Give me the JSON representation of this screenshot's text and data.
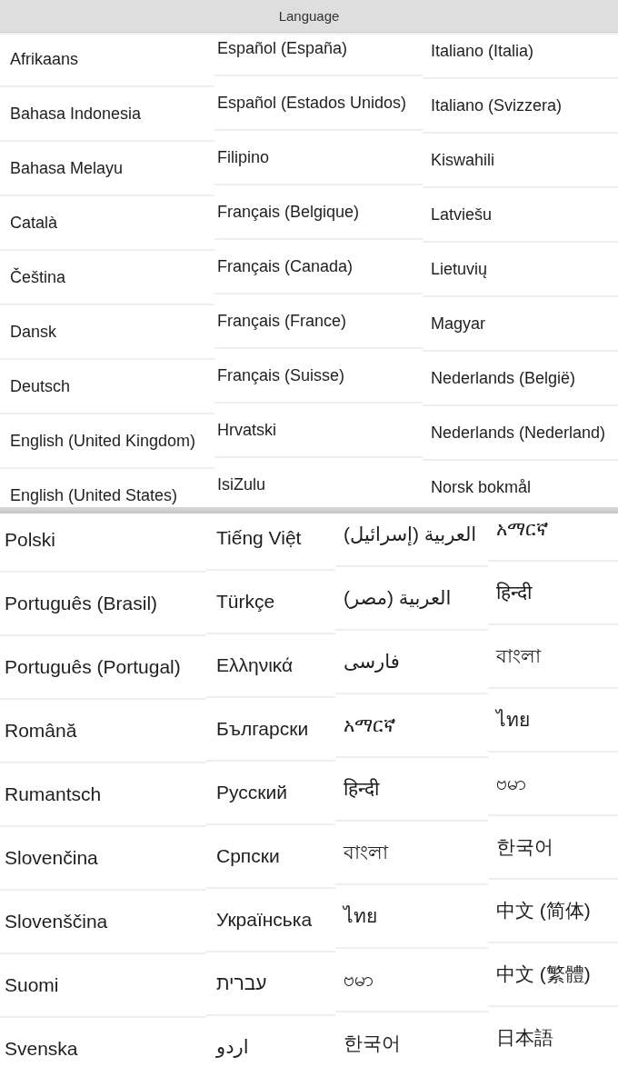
{
  "top_screen": {
    "title": "Language",
    "columns": [
      [
        "Afrikaans",
        "Bahasa Indonesia",
        "Bahasa Melayu",
        "Català",
        "Čeština",
        "Dansk",
        "Deutsch",
        "English (United Kingdom)",
        "English (United States)"
      ],
      [
        "Español (España)",
        "Español (Estados Unidos)",
        "Filipino",
        "Français (Belgique)",
        "Français (Canada)",
        "Français (France)",
        "Français (Suisse)",
        "Hrvatski",
        "IsiZulu"
      ],
      [
        "Italiano (Italia)",
        "Italiano (Svizzera)",
        "Kiswahili",
        "Latviešu",
        "Lietuvių",
        "Magyar",
        "Nederlands (België)",
        "Nederlands (Nederland)",
        "Norsk bokmål"
      ]
    ]
  },
  "bottom_screen": {
    "columns": [
      [
        "Polski",
        "Português (Brasil)",
        "Português (Portugal)",
        "Română",
        "Rumantsch",
        "Slovenčina",
        "Slovenščina",
        "Suomi",
        "Svenska"
      ],
      [
        "Tiếng Việt",
        "Türkçe",
        "Ελληνικά",
        "Български",
        "Русский",
        "Српски",
        "Українська",
        "עברית",
        "اردو"
      ],
      [
        "العربية (إسرائيل)",
        "العربية (مصر)",
        "فارسی",
        "አማርኛ",
        "हिन्दी",
        "বাংলা",
        "ไทย",
        "ဗမာ",
        "한국어"
      ],
      [
        "አማርኛ",
        "हिन्दी",
        "বাংলা",
        "ไทย",
        "ဗမာ",
        "한국어",
        "中文 (简体)",
        "中文 (繁體)",
        "日本語"
      ]
    ]
  }
}
